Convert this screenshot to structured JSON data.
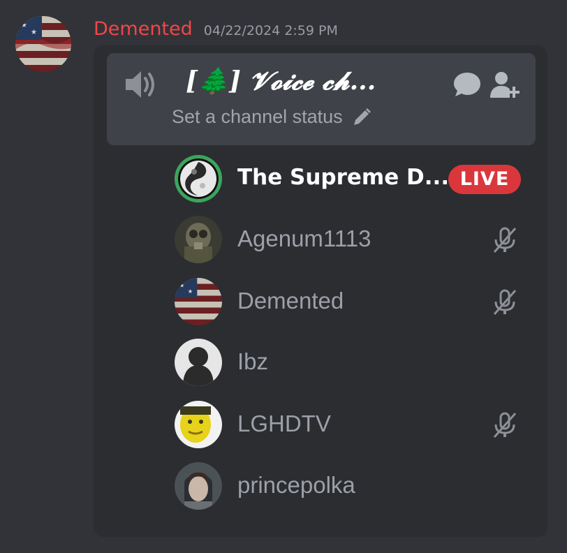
{
  "message": {
    "author": "Demented",
    "timestamp": "04/22/2024 2:59 PM",
    "author_color": "#f04747"
  },
  "channel": {
    "name": "[🌲] 𝓥𝓸𝓲𝓬𝓮 𝓬𝓱...",
    "status_placeholder": "Set a channel status",
    "icons": [
      "speaker-icon",
      "chat-icon",
      "add-user-icon",
      "pencil-icon"
    ]
  },
  "members": [
    {
      "name": "The Supreme D...",
      "badge": "LIVE",
      "speaking": true,
      "muted": false
    },
    {
      "name": "Agenum1113",
      "muted": true
    },
    {
      "name": "Demented",
      "muted": true
    },
    {
      "name": "Ibz",
      "muted": false
    },
    {
      "name": "LGHDTV",
      "muted": true
    },
    {
      "name": "princepolka",
      "muted": false
    }
  ],
  "colors": {
    "background": "#323338",
    "card": "#2b2d31",
    "header": "#404249",
    "live": "#da373c",
    "speaking_ring": "#3ba55c",
    "muted_text": "#9da0a8"
  }
}
